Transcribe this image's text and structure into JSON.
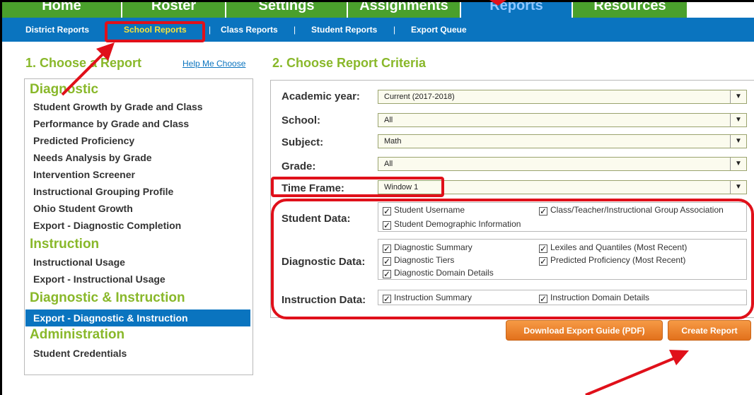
{
  "top_tabs": [
    "Home",
    "Roster",
    "Settings",
    "Assignments",
    "Reports",
    "Resources"
  ],
  "sub_nav": {
    "items": [
      "District Reports",
      "School Reports",
      "Class Reports",
      "Student Reports",
      "Export Queue"
    ],
    "separator": "|"
  },
  "choose_report": {
    "heading": "1. Choose a Report",
    "help_link": "Help Me Choose",
    "categories": [
      {
        "name": "Diagnostic",
        "items": [
          "Student Growth by Grade and Class",
          "Performance by Grade and Class",
          "Predicted Proficiency",
          "Needs Analysis by Grade",
          "Intervention Screener",
          "Instructional Grouping Profile",
          "Ohio Student Growth",
          "Export - Diagnostic Completion"
        ]
      },
      {
        "name": "Instruction",
        "items": [
          "Instructional Usage",
          "Export - Instructional Usage"
        ]
      },
      {
        "name": "Diagnostic & Instruction",
        "items": [
          "Export - Diagnostic & Instruction"
        ]
      },
      {
        "name": "Administration",
        "items": [
          "Student Credentials"
        ]
      }
    ],
    "selected_item": "Export - Diagnostic & Instruction"
  },
  "criteria": {
    "heading": "2. Choose Report Criteria",
    "fields": [
      {
        "label": "Academic year:",
        "value": "Current (2017-2018)"
      },
      {
        "label": "School:",
        "value": "All"
      },
      {
        "label": "Subject:",
        "value": "Math"
      },
      {
        "label": "Grade:",
        "value": "All"
      },
      {
        "label": "Time Frame:",
        "value": "Window 1"
      }
    ],
    "student_data": {
      "label": "Student Data:",
      "options": [
        "Student Username",
        "Class/Teacher/Instructional Group Association",
        "Student Demographic Information"
      ]
    },
    "diagnostic_data": {
      "label": "Diagnostic Data:",
      "options": [
        "Diagnostic Summary",
        "Lexiles and Quantiles (Most Recent)",
        "Diagnostic Tiers",
        "Predicted Proficiency (Most Recent)",
        "Diagnostic Domain Details"
      ]
    },
    "instruction_data": {
      "label": "Instruction Data:",
      "options": [
        "Instruction Summary",
        "Instruction Domain Details"
      ]
    },
    "check_glyph": "✓",
    "dropdown_glyph": "▼"
  },
  "buttons": {
    "download": "Download Export Guide (PDF)",
    "create": "Create Report"
  },
  "colors": {
    "green": "#4aa02c",
    "blue": "#0a74bf",
    "heading_green": "#89b82a",
    "orange": "#e2711c",
    "annotation_red": "#e0101a"
  }
}
